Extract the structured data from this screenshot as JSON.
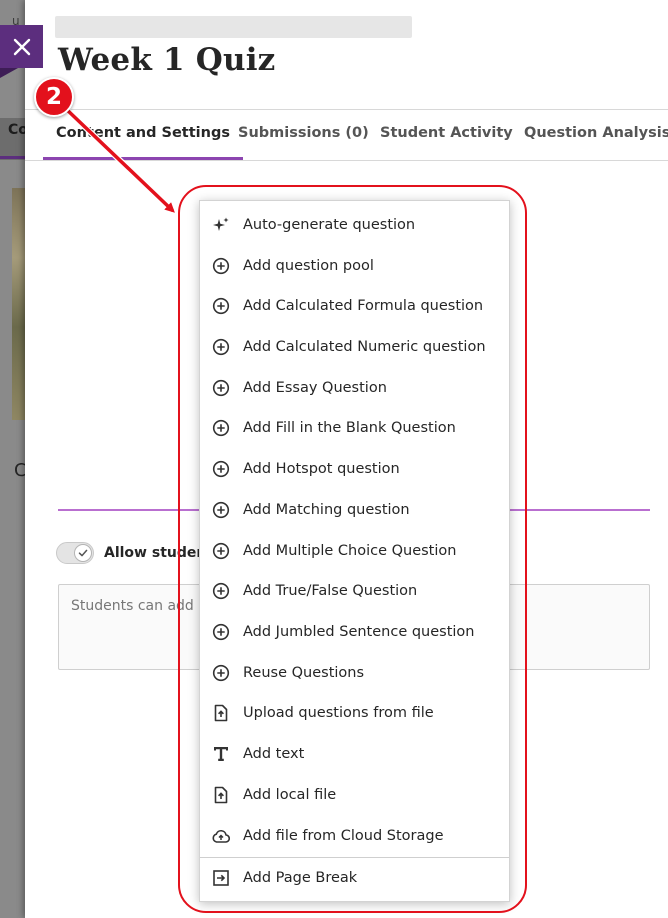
{
  "quiz": {
    "title": "Week 1 Quiz"
  },
  "tabs": [
    {
      "label": "Content and Settings"
    },
    {
      "label": "Submissions (0)"
    },
    {
      "label": "Student Activity"
    },
    {
      "label": "Question Analysis"
    }
  ],
  "background": {
    "nav_fragment": "Co",
    "letter_fragment": "C",
    "top_fragment": "u"
  },
  "settings": {
    "allow_label": "Allow studen",
    "textarea_placeholder": "Students can add"
  },
  "add_menu": {
    "items": [
      {
        "label": "Auto-generate question",
        "icon": "sparkle-icon"
      },
      {
        "label": "Add question pool",
        "icon": "plus-circle-icon"
      },
      {
        "label": "Add Calculated Formula question",
        "icon": "plus-circle-icon"
      },
      {
        "label": "Add Calculated Numeric question",
        "icon": "plus-circle-icon"
      },
      {
        "label": "Add Essay Question",
        "icon": "plus-circle-icon"
      },
      {
        "label": "Add Fill in the Blank Question",
        "icon": "plus-circle-icon"
      },
      {
        "label": "Add Hotspot question",
        "icon": "plus-circle-icon"
      },
      {
        "label": "Add Matching question",
        "icon": "plus-circle-icon"
      },
      {
        "label": "Add Multiple Choice Question",
        "icon": "plus-circle-icon"
      },
      {
        "label": "Add True/False Question",
        "icon": "plus-circle-icon"
      },
      {
        "label": "Add Jumbled Sentence question",
        "icon": "plus-circle-icon"
      },
      {
        "label": "Reuse Questions",
        "icon": "plus-circle-icon"
      },
      {
        "label": "Upload questions from file",
        "icon": "file-upload-icon"
      },
      {
        "label": "Add text",
        "icon": "text-icon"
      },
      {
        "label": "Add local file",
        "icon": "file-upload-icon"
      },
      {
        "label": "Add file from Cloud Storage",
        "icon": "cloud-upload-icon"
      },
      {
        "label": "Add Page Break",
        "icon": "page-break-icon"
      }
    ]
  },
  "callout": {
    "step_number": "2"
  },
  "colors": {
    "brand_purple": "#5c2e7e",
    "tab_underline": "#8c45b0",
    "callout_red": "#e3111c"
  }
}
